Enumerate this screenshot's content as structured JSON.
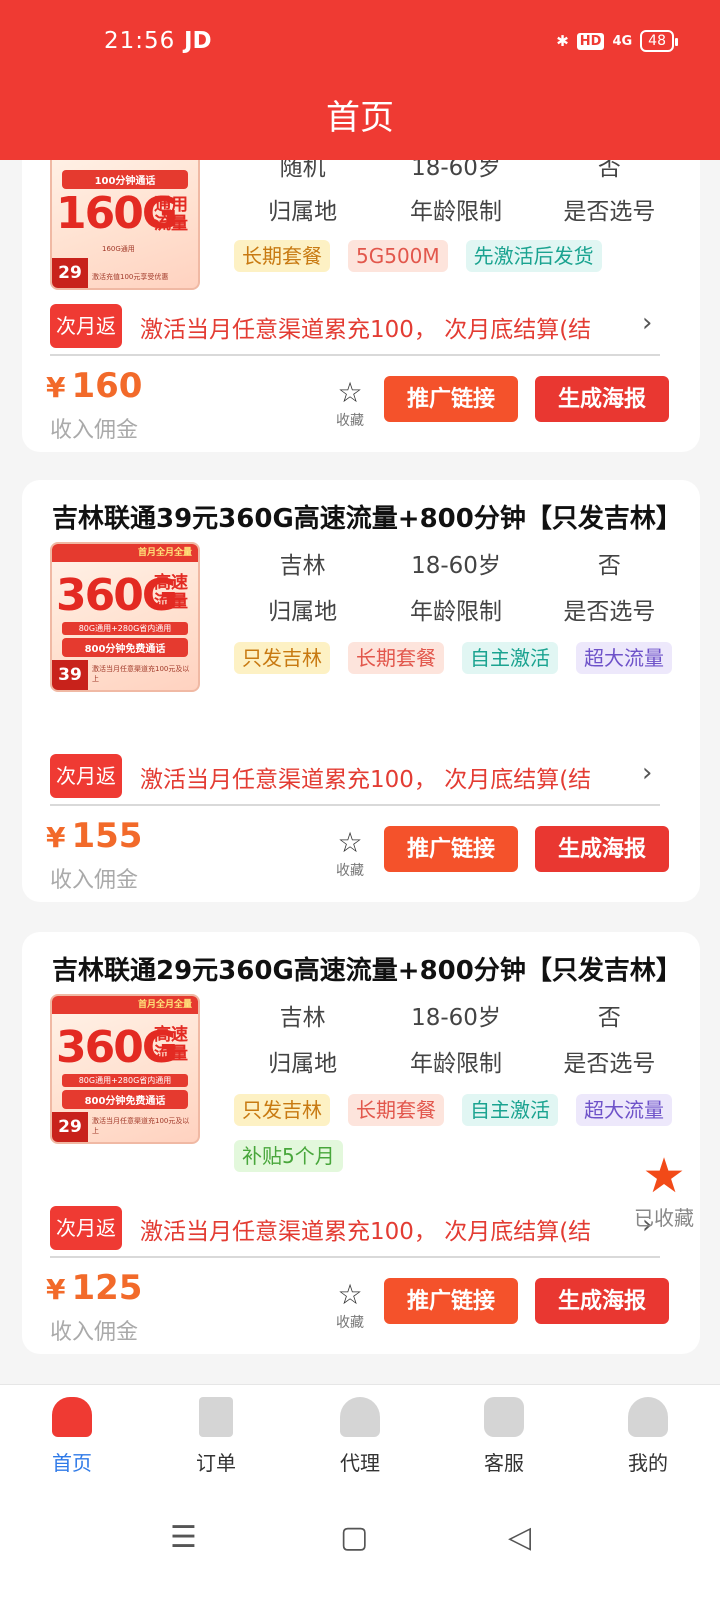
{
  "status": {
    "time": "21:56",
    "carrier": "JD",
    "hd": "HD",
    "signal": "4G",
    "battery": "48"
  },
  "header": {
    "title": "首页"
  },
  "cards": [
    {
      "title": "",
      "image": {
        "badge": "",
        "big": "160G",
        "side": "通用流量",
        "sub": "160G通用",
        "strip": "100分钟通话",
        "price": "29",
        "note": "激活充值100元享受优惠"
      },
      "attrs": {
        "region": "随机",
        "age": "18-60岁",
        "select": "否"
      },
      "labels": {
        "region": "归属地",
        "age": "年龄限制",
        "select": "是否选号"
      },
      "tags": [
        "长期套餐",
        "5G500M",
        "先激活后发货"
      ],
      "rebate_badge": "次月返",
      "rebate_text": "激活当月任意渠道累充100， 次月底结算(结",
      "price": "160",
      "income_label": "收入佣金",
      "fav_label": "收藏",
      "promo_label": "推广链接",
      "poster_label": "生成海报"
    },
    {
      "title": "吉林联通39元360G高速流量+800分钟【只发吉林】",
      "image": {
        "badge": "首月全月全量",
        "big": "360G",
        "side": "高速流量",
        "sub": "80G通用+280G省内通用",
        "strip": "800分钟免费通话",
        "price": "39",
        "note": "激活当月任意渠道充100元及以上"
      },
      "attrs": {
        "region": "吉林",
        "age": "18-60岁",
        "select": "否"
      },
      "labels": {
        "region": "归属地",
        "age": "年龄限制",
        "select": "是否选号"
      },
      "tags": [
        "只发吉林",
        "长期套餐",
        "自主激活",
        "超大流量"
      ],
      "rebate_badge": "次月返",
      "rebate_text": "激活当月任意渠道累充100， 次月底结算(结",
      "price": "155",
      "income_label": "收入佣金",
      "fav_label": "收藏",
      "promo_label": "推广链接",
      "poster_label": "生成海报"
    },
    {
      "title": "吉林联通29元360G高速流量+800分钟【只发吉林】",
      "image": {
        "badge": "首月全月全量",
        "big": "360G",
        "side": "高速流量",
        "sub": "80G通用+280G省内通用",
        "strip": "800分钟免费通话",
        "price": "29",
        "note": "激活当月任意渠道充100元及以上"
      },
      "attrs": {
        "region": "吉林",
        "age": "18-60岁",
        "select": "否"
      },
      "labels": {
        "region": "归属地",
        "age": "年龄限制",
        "select": "是否选号"
      },
      "tags": [
        "只发吉林",
        "长期套餐",
        "自主激活",
        "超大流量",
        "补贴5个月"
      ],
      "rebate_badge": "次月返",
      "rebate_text": "激活当月任意渠道累充100， 次月底结算(结",
      "price": "125",
      "income_label": "收入佣金",
      "fav_label": "收藏",
      "promo_label": "推广链接",
      "poster_label": "生成海报"
    }
  ],
  "floating_fav": {
    "label": "已收藏"
  },
  "tabbar": {
    "items": [
      {
        "label": "首页",
        "icon": "home-icon",
        "active": true
      },
      {
        "label": "订单",
        "icon": "order-icon",
        "active": false
      },
      {
        "label": "代理",
        "icon": "agent-icon",
        "active": false
      },
      {
        "label": "客服",
        "icon": "service-icon",
        "active": false
      },
      {
        "label": "我的",
        "icon": "profile-icon",
        "active": false
      }
    ]
  },
  "colors": {
    "brand": "#ef3a33",
    "price": "#f26a2a",
    "tab_active": "#2f7ae8"
  }
}
